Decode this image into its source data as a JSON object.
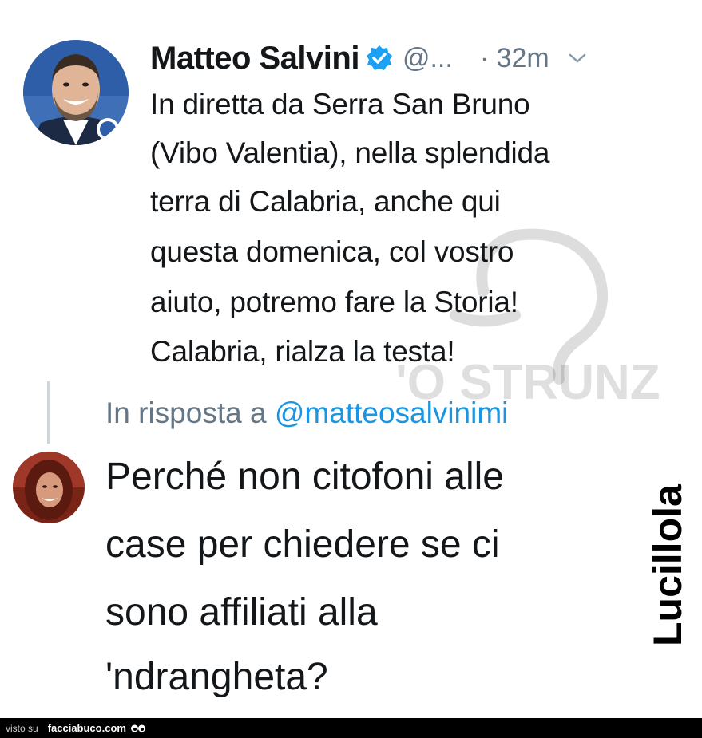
{
  "tweet": {
    "author_name": "Matteo Salvini",
    "handle": "@...",
    "timestamp": "· 32m",
    "verified_icon": "verified-badge-icon",
    "caret_icon": "chevron-down-icon",
    "text_lines": [
      "In diretta da Serra San Bruno",
      "(Vibo Valentia), nella splendida",
      "terra di Calabria, anche qui",
      "questa domenica, col vostro",
      "aiuto, potremo fare la Storia!",
      "Calabria, rialza la testa!"
    ]
  },
  "reply": {
    "reply_prefix": "In risposta a",
    "reply_handle": "@matteosalvinimi",
    "text_lines": [
      "Perché non citofoni alle",
      "case per chiedere se ci",
      "sono affiliati alla",
      "'ndrangheta?"
    ]
  },
  "side_signature": "Lucillola",
  "watermark_text": "'O STRUNZ",
  "footer": {
    "prefix": "visto su",
    "site": "facciabuco.com"
  },
  "colors": {
    "text": "#14171a",
    "secondary": "#657786",
    "link": "#1b95e0",
    "verified": "#1da1f2",
    "footer_bg": "#000000"
  }
}
